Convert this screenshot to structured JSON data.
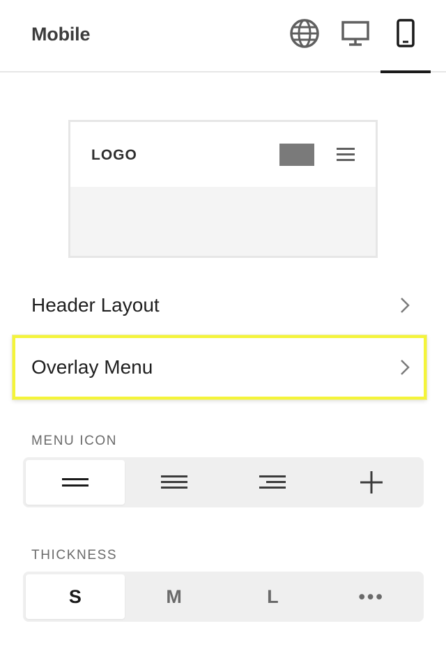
{
  "header": {
    "title": "Mobile",
    "icons": [
      "globe-icon",
      "desktop-icon",
      "mobile-icon"
    ],
    "active_tab": "mobile"
  },
  "preview": {
    "logo_text": "LOGO"
  },
  "nav": {
    "header_layout": "Header Layout",
    "overlay_menu": "Overlay Menu"
  },
  "menu_icon": {
    "label": "MENU ICON",
    "options": [
      "two-lines-icon",
      "three-lines-icon",
      "right-aligned-lines-icon",
      "plus-icon"
    ],
    "selected_index": 0
  },
  "thickness": {
    "label": "THICKNESS",
    "options": [
      "S",
      "M",
      "L",
      "•••"
    ],
    "selected_index": 0
  },
  "colors": {
    "highlight": "#f4f43a",
    "active_underline": "#1a1a1a",
    "segment_bg": "#efefef"
  }
}
